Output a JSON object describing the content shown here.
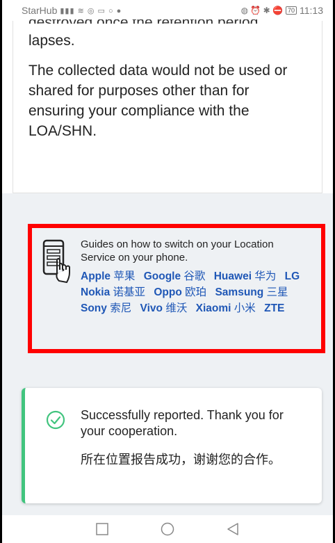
{
  "status_bar": {
    "carrier": "StarHub",
    "signal_icons": "▮▮▮ ≋ ◎ ▭ ○ ●",
    "right_icons": "◍ ⏰ ✱ ⛔",
    "battery": "70",
    "time": "11:13"
  },
  "content": {
    "cut_line": "destroyed once the retention period",
    "lapses": "lapses.",
    "collected_data": "The collected data would not be used or shared for purposes other than for ensuring your compliance with the LOA/SHN."
  },
  "guide": {
    "icon": "phone-touch-icon",
    "intro": "Guides on how to switch on your Location Service on your phone.",
    "links": [
      {
        "label": "Apple",
        "zh": "苹果"
      },
      {
        "label": "Google",
        "zh": "谷歌"
      },
      {
        "label": "Huawei",
        "zh": "华为"
      },
      {
        "label": "LG",
        "zh": ""
      },
      {
        "label": "Nokia",
        "zh": "诺基亚"
      },
      {
        "label": "Oppo",
        "zh": "欧珀"
      },
      {
        "label": "Samsung",
        "zh": "三星"
      },
      {
        "label": "Sony",
        "zh": "索尼"
      },
      {
        "label": "Vivo",
        "zh": "维沃"
      },
      {
        "label": "Xiaomi",
        "zh": "小米"
      },
      {
        "label": "ZTE",
        "zh": ""
      }
    ],
    "highlight_color": "#ff0000",
    "link_color": "#1f57b6"
  },
  "toast": {
    "icon": "check-circle-icon",
    "message": "Successfully reported. Thank you for your cooperation.",
    "message_zh": "所在位置报告成功，谢谢您的合作。",
    "accent": "#41c47e"
  },
  "nav": {
    "recents_icon": "square-icon",
    "home_icon": "circle-icon",
    "back_icon": "triangle-back-icon"
  }
}
